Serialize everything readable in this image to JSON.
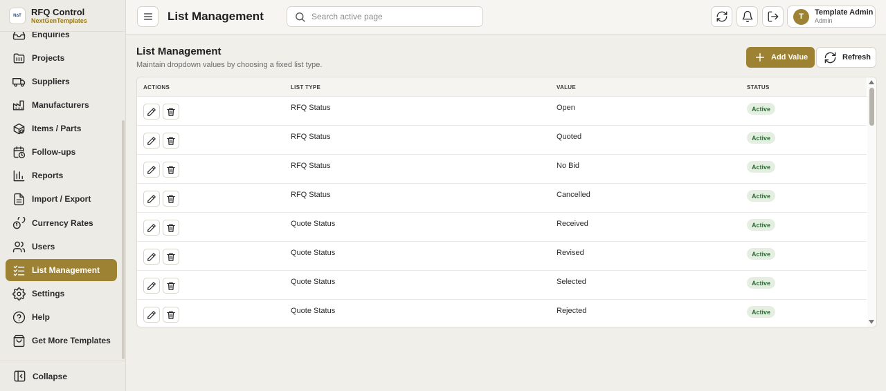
{
  "brand": {
    "logo_text": "N∆T",
    "title": "RFQ Control",
    "subtitle": "NextGenTemplates"
  },
  "sidebar": {
    "items": [
      {
        "label": "Enquiries",
        "icon": "inbox-icon"
      },
      {
        "label": "Projects",
        "icon": "folder-icon"
      },
      {
        "label": "Suppliers",
        "icon": "truck-icon"
      },
      {
        "label": "Manufacturers",
        "icon": "factory-icon"
      },
      {
        "label": "Items / Parts",
        "icon": "package-icon"
      },
      {
        "label": "Follow-ups",
        "icon": "calendar-clock-icon"
      },
      {
        "label": "Reports",
        "icon": "bar-chart-icon"
      },
      {
        "label": "Import / Export",
        "icon": "file-icon"
      },
      {
        "label": "Currency Rates",
        "icon": "coins-icon"
      },
      {
        "label": "Users",
        "icon": "users-icon"
      },
      {
        "label": "List Management",
        "icon": "list-check-icon",
        "active": true
      },
      {
        "label": "Settings",
        "icon": "gear-icon"
      },
      {
        "label": "Help",
        "icon": "help-circle-icon"
      },
      {
        "label": "Get More Templates",
        "icon": "shopping-bag-icon"
      }
    ],
    "collapse_label": "Collapse"
  },
  "topbar": {
    "title": "List Management",
    "search_placeholder": "Search active page",
    "user": {
      "initial": "T",
      "name": "Template Admin",
      "role": "Admin"
    }
  },
  "page": {
    "title": "List Management",
    "subtitle": "Maintain dropdown values by choosing a fixed list type.",
    "add_label": "Add Value",
    "refresh_label": "Refresh"
  },
  "table": {
    "columns": [
      "ACTIONS",
      "LIST TYPE",
      "VALUE",
      "STATUS"
    ],
    "rows": [
      {
        "list_type": "RFQ Status",
        "value": "Open",
        "status": "Active"
      },
      {
        "list_type": "RFQ Status",
        "value": "Quoted",
        "status": "Active"
      },
      {
        "list_type": "RFQ Status",
        "value": "No Bid",
        "status": "Active"
      },
      {
        "list_type": "RFQ Status",
        "value": "Cancelled",
        "status": "Active"
      },
      {
        "list_type": "Quote Status",
        "value": "Received",
        "status": "Active"
      },
      {
        "list_type": "Quote Status",
        "value": "Revised",
        "status": "Active"
      },
      {
        "list_type": "Quote Status",
        "value": "Selected",
        "status": "Active"
      },
      {
        "list_type": "Quote Status",
        "value": "Rejected",
        "status": "Active"
      }
    ]
  },
  "colors": {
    "accent": "#9d8233",
    "badge_bg": "#e4efe2",
    "badge_text": "#2e6b35"
  }
}
